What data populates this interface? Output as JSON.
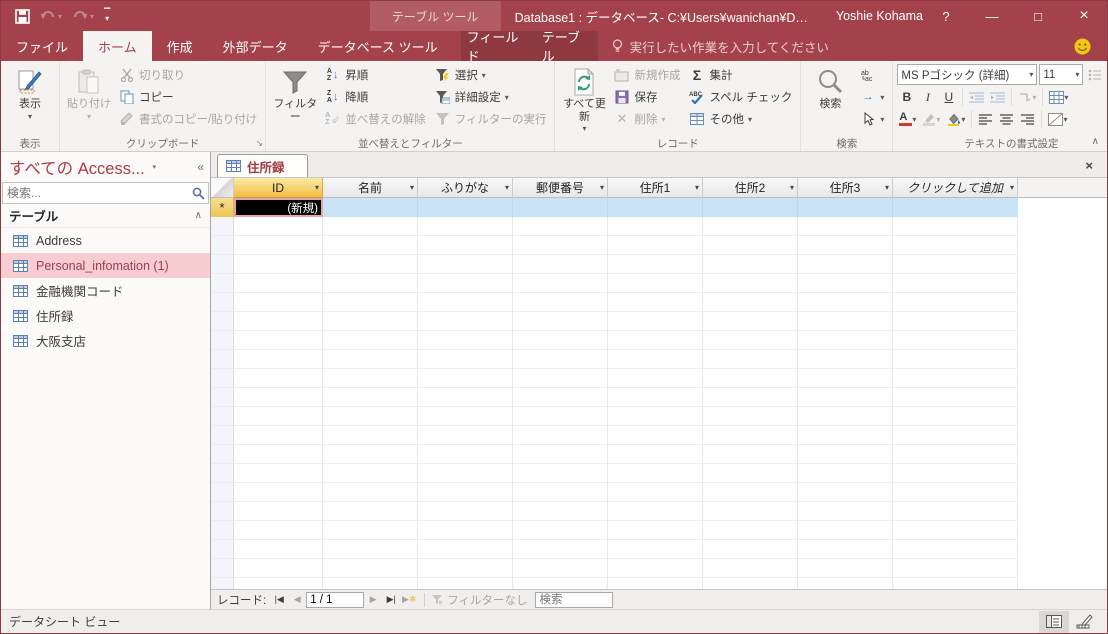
{
  "titlebar": {
    "contextual_tool": "テーブル ツール",
    "title": "Database1 : データベース- C:¥Users¥wanichan¥D…",
    "user": "Yoshie Kohama",
    "help": "?"
  },
  "icons": {
    "minimize": "—",
    "maximize": "□",
    "close": "×",
    "dropdown": "▾",
    "collapse_ribbon": "∧",
    "shutter": "«",
    "section_collapse": "∧",
    "asterisk": "*",
    "sigma": "Σ",
    "goto_arrow": "→",
    "first": "◀",
    "prev": "◀",
    "next": "▶",
    "last": "▶",
    "new_rec": "▶",
    "doc_close": "×"
  },
  "tabs": {
    "file": "ファイル",
    "home": "ホーム",
    "create": "作成",
    "external_data": "外部データ",
    "db_tools": "データベース ツール",
    "fields": "フィールド",
    "table": "テーブル",
    "tellme": "実行したい作業を入力してください"
  },
  "ribbon": {
    "views": {
      "view": "表示",
      "group": "表示"
    },
    "clipboard": {
      "paste": "貼り付け",
      "cut": "切り取り",
      "copy": "コピー",
      "format_painter": "書式のコピー/貼り付け",
      "group": "クリップボード"
    },
    "sort_filter": {
      "filter": "フィルター",
      "ascending": "昇順",
      "descending": "降順",
      "clear_sort": "並べ替えの解除",
      "selection": "選択",
      "advanced": "詳細設定",
      "toggle_filter": "フィルターの実行",
      "group": "並べ替えとフィルター"
    },
    "records": {
      "refresh_all": "すべて更新",
      "new": "新規作成",
      "save": "保存",
      "delete": "削除",
      "totals": "集計",
      "spelling": "スペル チェック",
      "more": "その他",
      "group": "レコード"
    },
    "find": {
      "find": "検索",
      "group": "検索"
    },
    "text_format": {
      "font_name": "MS Pゴシック (詳細)",
      "font_size": "11",
      "bold": "B",
      "italic": "I",
      "underline": "U",
      "font_color": "A",
      "group": "テキストの書式設定"
    }
  },
  "nav_pane": {
    "title": "すべての Access...",
    "search_placeholder": "検索...",
    "section": "テーブル",
    "items": [
      {
        "label": "Address"
      },
      {
        "label": "Personal_infomation (1)"
      },
      {
        "label": "金融機関コード"
      },
      {
        "label": "住所録"
      },
      {
        "label": "大阪支店"
      }
    ]
  },
  "document": {
    "tab": "住所録"
  },
  "datasheet": {
    "columns": [
      "ID",
      "名前",
      "ふりがな",
      "郵便番号",
      "住所1",
      "住所2",
      "住所3"
    ],
    "add_column": "クリックして追加",
    "new_record_value": "(新規)"
  },
  "record_nav": {
    "label": "レコード:",
    "position": "1 / 1",
    "filter_status": "フィルターなし",
    "search_placeholder": "検索"
  },
  "status_bar": {
    "view_name": "データシート ビュー"
  },
  "colors": {
    "accent": "#A4424B",
    "contextual_title": "#B25D64",
    "contextual_tabs": "#8E3840",
    "id_header": "#F1BF45",
    "new_row": "#CBE3F7",
    "selection_border": "#E9A2AA",
    "selected_nav_item": "#F7CDD2"
  }
}
